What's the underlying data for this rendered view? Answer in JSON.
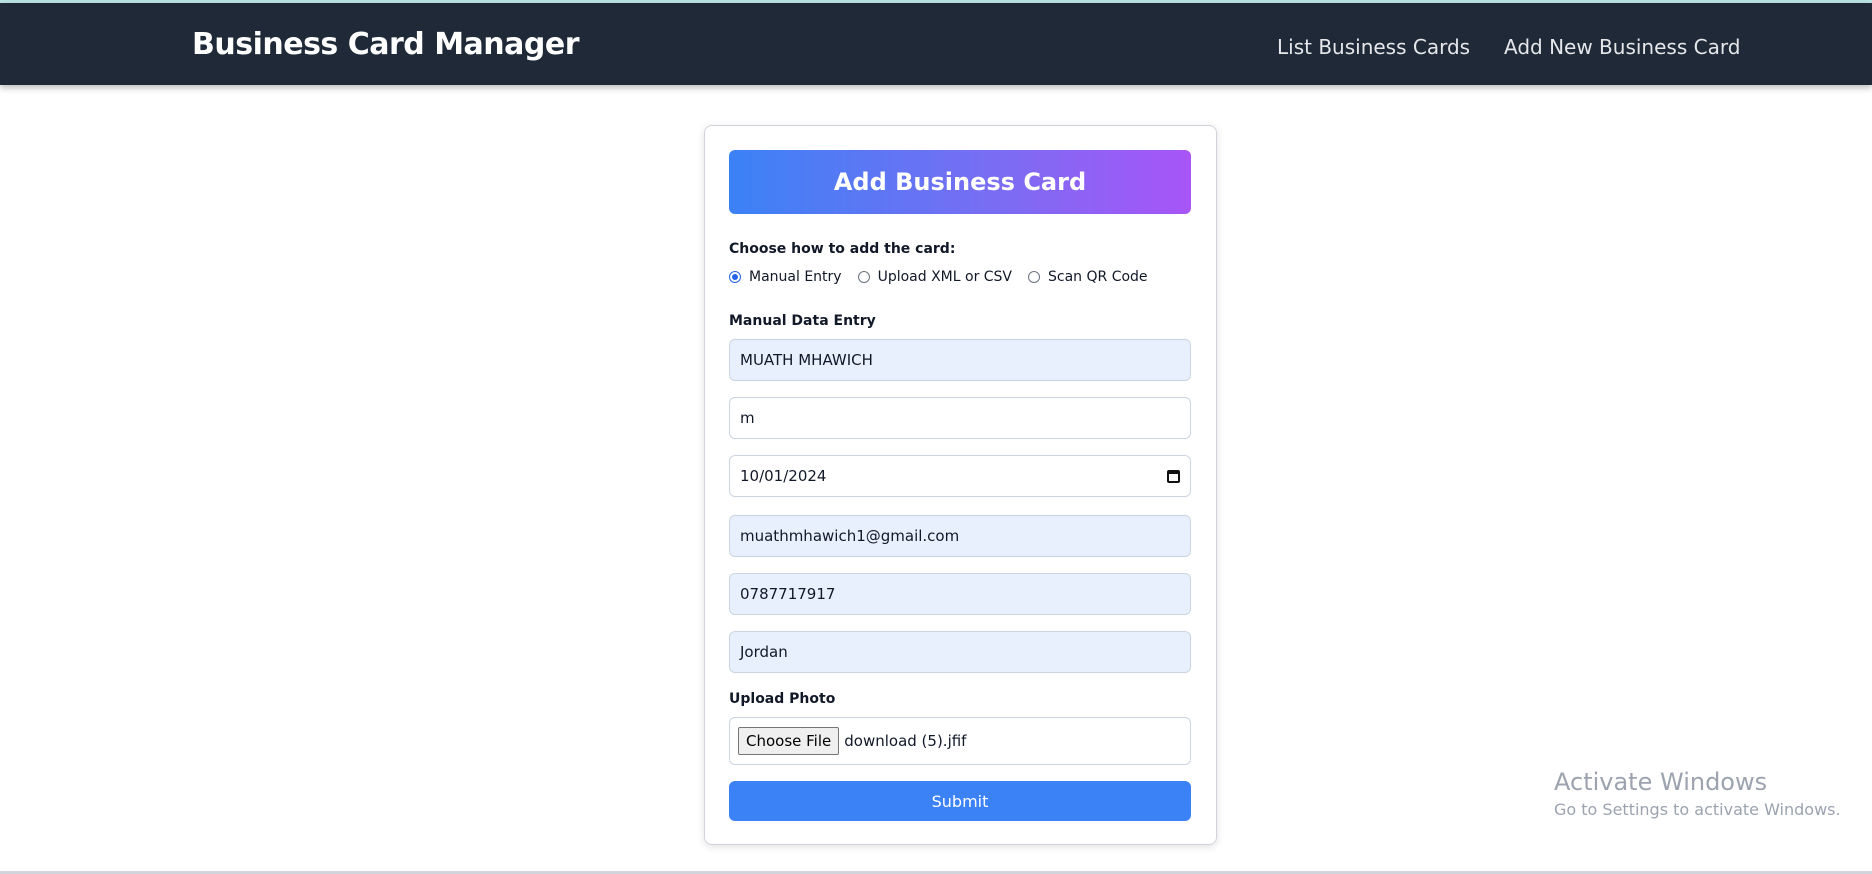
{
  "navbar": {
    "brand": "Business Card Manager",
    "links": [
      {
        "label": "List Business Cards"
      },
      {
        "label": "Add New Business Card"
      }
    ]
  },
  "form": {
    "title": "Add Business Card",
    "choose_label": "Choose how to add the card:",
    "options": [
      {
        "label": "Manual Entry",
        "checked": true
      },
      {
        "label": "Upload XML or CSV",
        "checked": false
      },
      {
        "label": "Scan QR Code",
        "checked": false
      }
    ],
    "manual_label": "Manual Data Entry",
    "fields": {
      "name": "MUATH MHAWICH",
      "gender": "m",
      "date": "10/01/2024",
      "email": "muathmhawich1@gmail.com",
      "phone": "0787717917",
      "address": "Jordan"
    },
    "upload_label": "Upload Photo",
    "file_button": "Choose File",
    "file_name": "download (5).jfif",
    "submit": "Submit"
  },
  "watermark": {
    "title": "Activate Windows",
    "subtitle": "Go to Settings to activate Windows."
  },
  "colors": {
    "navbar": "#1f2937",
    "accent": "#3b82f6",
    "gradient_end": "#a855f7",
    "autofill_bg": "#e8f0fe"
  }
}
